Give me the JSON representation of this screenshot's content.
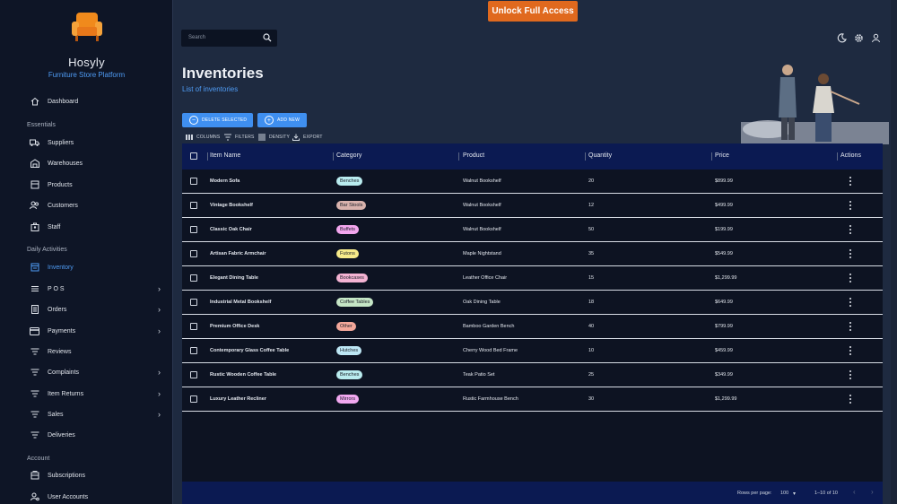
{
  "brand": {
    "name": "Hosyly",
    "tagline": "Furniture Store Platform",
    "logo_icon": "armchair-icon"
  },
  "topbar": {
    "unlock_label": "Unlock Full Access",
    "search_placeholder": "Search",
    "icons": [
      "dark-mode-icon",
      "settings-icon",
      "user-icon"
    ]
  },
  "sidebar": {
    "dashboard": "Dashboard",
    "sections": {
      "essentials": "Essentials",
      "daily": "Daily Activities",
      "account": "Account"
    },
    "items": [
      {
        "label": "Dashboard",
        "icon": "home-icon"
      },
      {
        "label": "Suppliers",
        "icon": "truck-icon"
      },
      {
        "label": "Warehouses",
        "icon": "warehouse-icon"
      },
      {
        "label": "Products",
        "icon": "product-icon"
      },
      {
        "label": "Customers",
        "icon": "customers-icon"
      },
      {
        "label": "Staff",
        "icon": "staff-icon"
      },
      {
        "label": "Inventory",
        "icon": "inventory-icon",
        "active": true
      },
      {
        "label": "P O S",
        "icon": "pos-icon",
        "expandable": true
      },
      {
        "label": "Orders",
        "icon": "orders-icon",
        "expandable": true
      },
      {
        "label": "Payments",
        "icon": "payments-icon",
        "expandable": true
      },
      {
        "label": "Reviews",
        "icon": "filter-lines-icon"
      },
      {
        "label": "Complaints",
        "icon": "filter-lines-icon",
        "expandable": true
      },
      {
        "label": "Item Returns",
        "icon": "filter-lines-icon",
        "expandable": true
      },
      {
        "label": "Sales",
        "icon": "filter-lines-icon",
        "expandable": true
      },
      {
        "label": "Deliveries",
        "icon": "filter-lines-icon"
      },
      {
        "label": "Subscriptions",
        "icon": "subscriptions-icon"
      },
      {
        "label": "User Accounts",
        "icon": "user-accounts-icon"
      }
    ]
  },
  "page": {
    "title": "Inventories",
    "subtitle": "List of inventories",
    "delete_label": "DELETE SELECTED",
    "add_label": "ADD NEW",
    "toolbar": {
      "columns": "COLUMNS",
      "filters": "FILTERS",
      "density": "DENSITY",
      "export": "EXPORT"
    }
  },
  "table": {
    "columns": [
      "Item Name",
      "Category",
      "Product",
      "Quantity",
      "Price",
      "Actions"
    ],
    "rows": [
      {
        "name": "Modern Sofa",
        "category": "Benches",
        "product": "Walnut Bookshelf",
        "quantity": "20",
        "price": "$899.99"
      },
      {
        "name": "Vintage Bookshelf",
        "category": "Bar Stools",
        "product": "Walnut Bookshelf",
        "quantity": "12",
        "price": "$499.99"
      },
      {
        "name": "Classic Oak Chair",
        "category": "Buffets",
        "product": "Walnut Bookshelf",
        "quantity": "50",
        "price": "$199.99"
      },
      {
        "name": "Artisan Fabric Armchair",
        "category": "Futons",
        "product": "Maple Nightstand",
        "quantity": "35",
        "price": "$549.99"
      },
      {
        "name": "Elegant Dining Table",
        "category": "Bookcases",
        "product": "Leather Office Chair",
        "quantity": "15",
        "price": "$1,299.99"
      },
      {
        "name": "Industrial Metal Bookshelf",
        "category": "Coffee Tables",
        "product": "Oak Dining Table",
        "quantity": "18",
        "price": "$649.99"
      },
      {
        "name": "Premium Office Desk",
        "category": "Other",
        "product": "Bamboo Garden Bench",
        "quantity": "40",
        "price": "$799.99"
      },
      {
        "name": "Contemporary Glass Coffee Table",
        "category": "Hutches",
        "product": "Cherry Wood Bed Frame",
        "quantity": "10",
        "price": "$459.99"
      },
      {
        "name": "Rustic Wooden Coffee Table",
        "category": "Benches",
        "product": "Teak Patio Set",
        "quantity": "25",
        "price": "$349.99"
      },
      {
        "name": "Luxury Leather Recliner",
        "category": "Mirrors",
        "product": "Rustic Farmhouse Bench",
        "quantity": "30",
        "price": "$1,299.99"
      }
    ],
    "chip_colors": {
      "Benches": "#b9ecef",
      "Bar Stools": "#d8b2ad",
      "Buffets": "#f2a6ee",
      "Futons": "#f7eb8a",
      "Bookcases": "#f4b3d3",
      "Coffee Tables": "#c5e6c6",
      "Other": "#f2a79a",
      "Hutches": "#bce6f4",
      "Mirrors": "#f1a8f0"
    }
  },
  "pagination": {
    "rows_per_page_label": "Rows per page:",
    "rows_per_page": "100",
    "range": "1–10 of 10"
  },
  "colors": {
    "accent": "#3f8ff0",
    "unlock": "#e0691e",
    "header": "#0b1a52",
    "sidebar": "#0e1526"
  }
}
